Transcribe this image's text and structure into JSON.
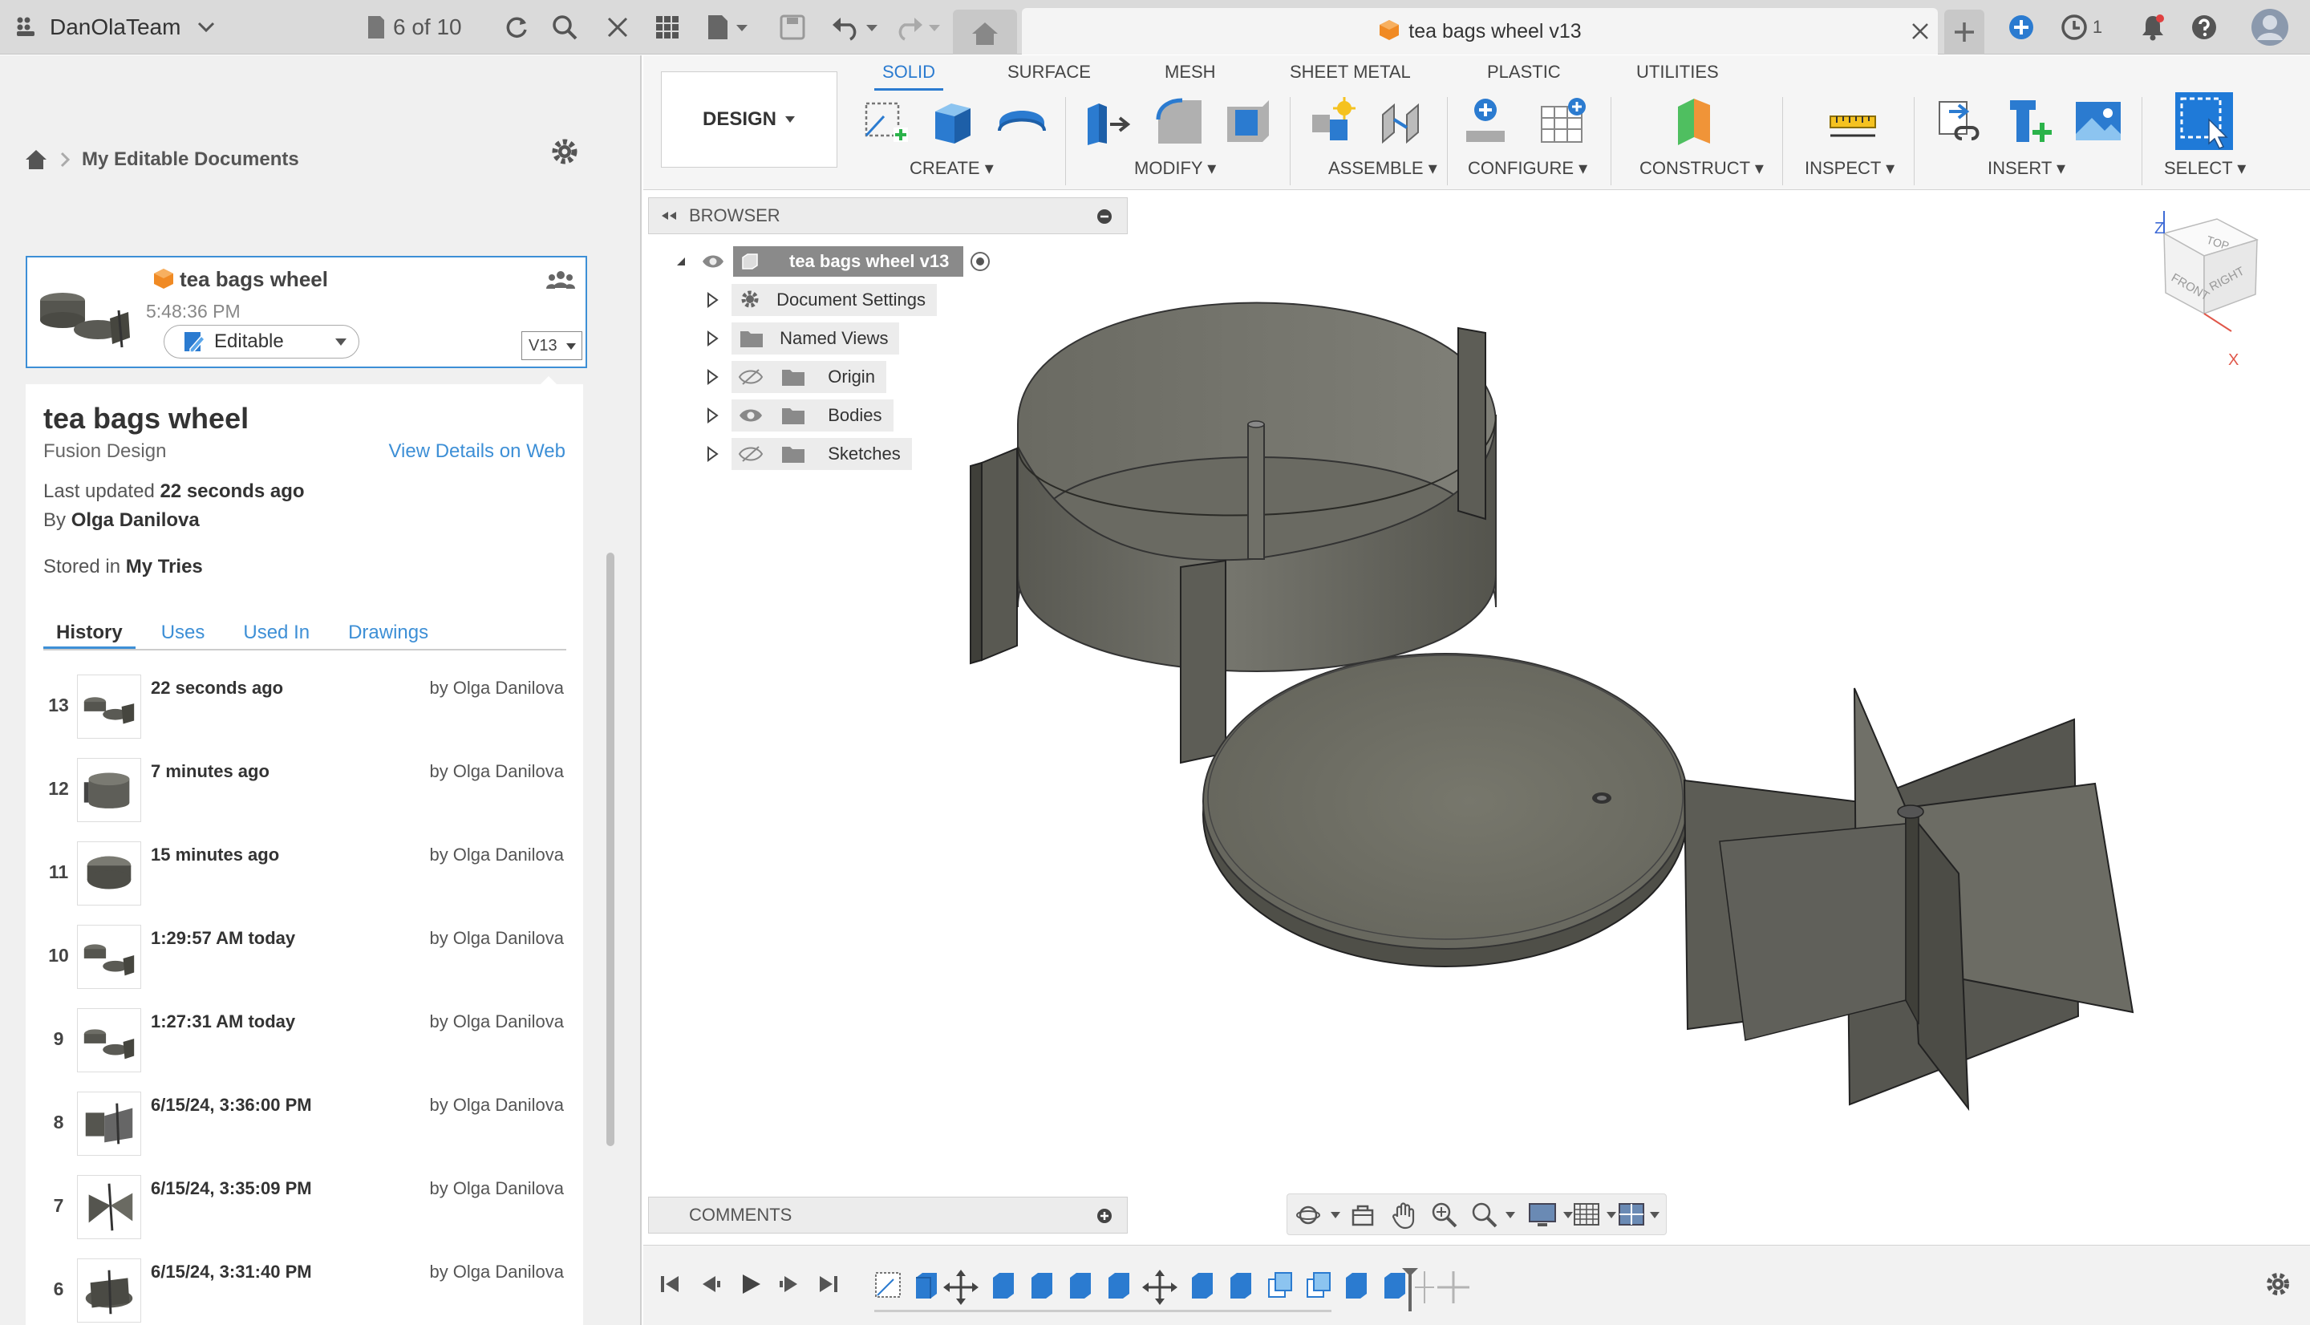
{
  "topbar": {
    "team_name": "DanOlaTeam",
    "page_count": "6 of 10",
    "doc_tab_title": "tea bags wheel v13",
    "job_count": "1"
  },
  "left_panel": {
    "breadcrumb": "My Editable Documents",
    "card": {
      "title": "tea bags wheel",
      "time": "5:48:36 PM",
      "status": "Editable",
      "version": "V13"
    },
    "detail": {
      "title": "tea bags wheel",
      "type": "Fusion Design",
      "view_web": "View Details on Web",
      "updated_prefix": "Last updated ",
      "updated_value": "22 seconds ago",
      "by_prefix": "By ",
      "by_value": "Olga Danilova",
      "stored_prefix": "Stored in ",
      "stored_value": "My Tries"
    },
    "tabs": [
      "History",
      "Uses",
      "Used In",
      "Drawings"
    ],
    "history": [
      {
        "num": "13",
        "time": "22 seconds ago",
        "by": "by Olga Danilova"
      },
      {
        "num": "12",
        "time": "7 minutes ago",
        "by": "by Olga Danilova"
      },
      {
        "num": "11",
        "time": "15 minutes ago",
        "by": "by Olga Danilova"
      },
      {
        "num": "10",
        "time": "1:29:57 AM today",
        "by": "by Olga Danilova"
      },
      {
        "num": "9",
        "time": "1:27:31 AM today",
        "by": "by Olga Danilova"
      },
      {
        "num": "8",
        "time": "6/15/24, 3:36:00 PM",
        "by": "by Olga Danilova"
      },
      {
        "num": "7",
        "time": "6/15/24, 3:35:09 PM",
        "by": "by Olga Danilova"
      },
      {
        "num": "6",
        "time": "6/15/24, 3:31:40 PM",
        "by": "by Olga Danilova"
      }
    ]
  },
  "toolbar": {
    "workspace": "DESIGN",
    "tabs": [
      "SOLID",
      "SURFACE",
      "MESH",
      "SHEET METAL",
      "PLASTIC",
      "UTILITIES"
    ],
    "groups": [
      "CREATE",
      "MODIFY",
      "ASSEMBLE",
      "CONFIGURE",
      "CONSTRUCT",
      "INSPECT",
      "INSERT",
      "SELECT"
    ]
  },
  "browser": {
    "title": "BROWSER",
    "root": "tea bags wheel v13",
    "items": [
      "Document Settings",
      "Named Views",
      "Origin",
      "Bodies",
      "Sketches"
    ]
  },
  "viewcube": {
    "top": "TOP",
    "front": "FRONT",
    "right": "RIGHT",
    "axis_z": "Z",
    "axis_x": "X"
  },
  "comments": {
    "title": "COMMENTS"
  },
  "colors": {
    "accent": "#2b7bd0",
    "model_fill": "#5e5e58",
    "model_dark": "#48483f",
    "fusion_orange": "#f08a24"
  }
}
